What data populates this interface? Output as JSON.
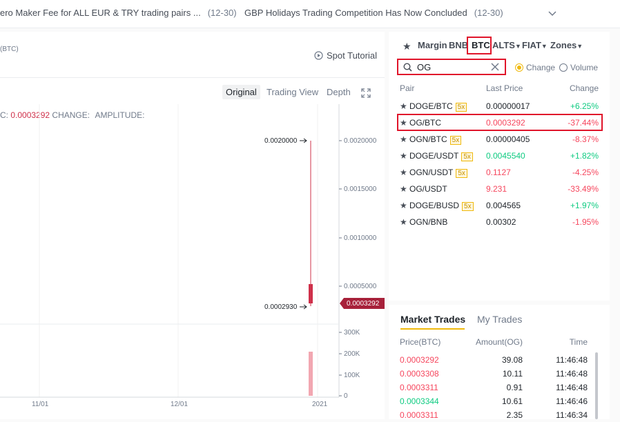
{
  "announcements": [
    {
      "text": "ero Maker Fee for ALL EUR & TRY trading pairs ...",
      "date": "(12-30)"
    },
    {
      "text": "GBP Holidays Trading Competition Has Now Concluded",
      "date": "(12-30)"
    }
  ],
  "chart": {
    "pair_label": "(BTC)",
    "spot_tutorial": "Spot Tutorial",
    "views": [
      "Original",
      "Trading View",
      "Depth"
    ],
    "active_view": "Original",
    "info": {
      "prefix": "C:",
      "price": "0.0003292",
      "change_label": "CHANGE:",
      "amplitude_label": "AMPLITUDE:"
    },
    "price_axis_ticks": [
      "0.0020000",
      "0.0015000",
      "0.0010000",
      "0.0005000"
    ],
    "volume_axis_ticks": [
      "300K",
      "200K",
      "100K",
      "0"
    ],
    "date_ticks": [
      "11/01",
      "12/01",
      "2021"
    ],
    "high_marker": "0.0020000",
    "low_marker": "0.0002930",
    "last_price_tag": "0.0003292",
    "colors": {
      "up": "#0ecb81",
      "down": "#cf304a",
      "tag": "#a7213a",
      "volume": "#f2a7b1"
    }
  },
  "market_filter": {
    "tabs": [
      "Margin",
      "BNB",
      "BTC",
      "ALTS",
      "FIAT",
      "Zones"
    ],
    "active_tab": "BTC",
    "search_value": "OG",
    "radio_change": "Change",
    "radio_volume": "Volume",
    "selected_radio": "Change"
  },
  "pairs_table": {
    "headers": [
      "Pair",
      "Last Price",
      "Change"
    ],
    "rows": [
      {
        "pair": "DOGE/BTC",
        "leverage": "5x",
        "price": "0.00000017",
        "change": "+6.25%",
        "price_color": "dark",
        "change_color": "green"
      },
      {
        "pair": "OG/BTC",
        "leverage": "",
        "price": "0.0003292",
        "change": "-37.44%",
        "price_color": "red",
        "change_color": "red"
      },
      {
        "pair": "OGN/BTC",
        "leverage": "5x",
        "price": "0.00000405",
        "change": "-8.37%",
        "price_color": "dark",
        "change_color": "red"
      },
      {
        "pair": "DOGE/USDT",
        "leverage": "5x",
        "price": "0.0045540",
        "change": "+1.82%",
        "price_color": "green",
        "change_color": "green"
      },
      {
        "pair": "OGN/USDT",
        "leverage": "5x",
        "price": "0.1127",
        "change": "-4.25%",
        "price_color": "red",
        "change_color": "red"
      },
      {
        "pair": "OG/USDT",
        "leverage": "",
        "price": "9.231",
        "change": "-33.49%",
        "price_color": "red",
        "change_color": "red"
      },
      {
        "pair": "DOGE/BUSD",
        "leverage": "5x",
        "price": "0.004565",
        "change": "+1.97%",
        "price_color": "dark",
        "change_color": "green"
      },
      {
        "pair": "OGN/BNB",
        "leverage": "",
        "price": "0.00302",
        "change": "-1.95%",
        "price_color": "dark",
        "change_color": "red"
      }
    ]
  },
  "trades": {
    "tabs": [
      "Market Trades",
      "My Trades"
    ],
    "active_tab": "Market Trades",
    "headers": [
      "Price(BTC)",
      "Amount(OG)",
      "Time"
    ],
    "rows": [
      {
        "price": "0.0003292",
        "amount": "39.08",
        "time": "11:46:48",
        "color": "red"
      },
      {
        "price": "0.0003308",
        "amount": "10.11",
        "time": "11:46:48",
        "color": "red"
      },
      {
        "price": "0.0003311",
        "amount": "0.91",
        "time": "11:46:48",
        "color": "red"
      },
      {
        "price": "0.0003344",
        "amount": "10.61",
        "time": "11:46:46",
        "color": "green"
      },
      {
        "price": "0.0003311",
        "amount": "2.35",
        "time": "11:46:34",
        "color": "red"
      }
    ]
  }
}
